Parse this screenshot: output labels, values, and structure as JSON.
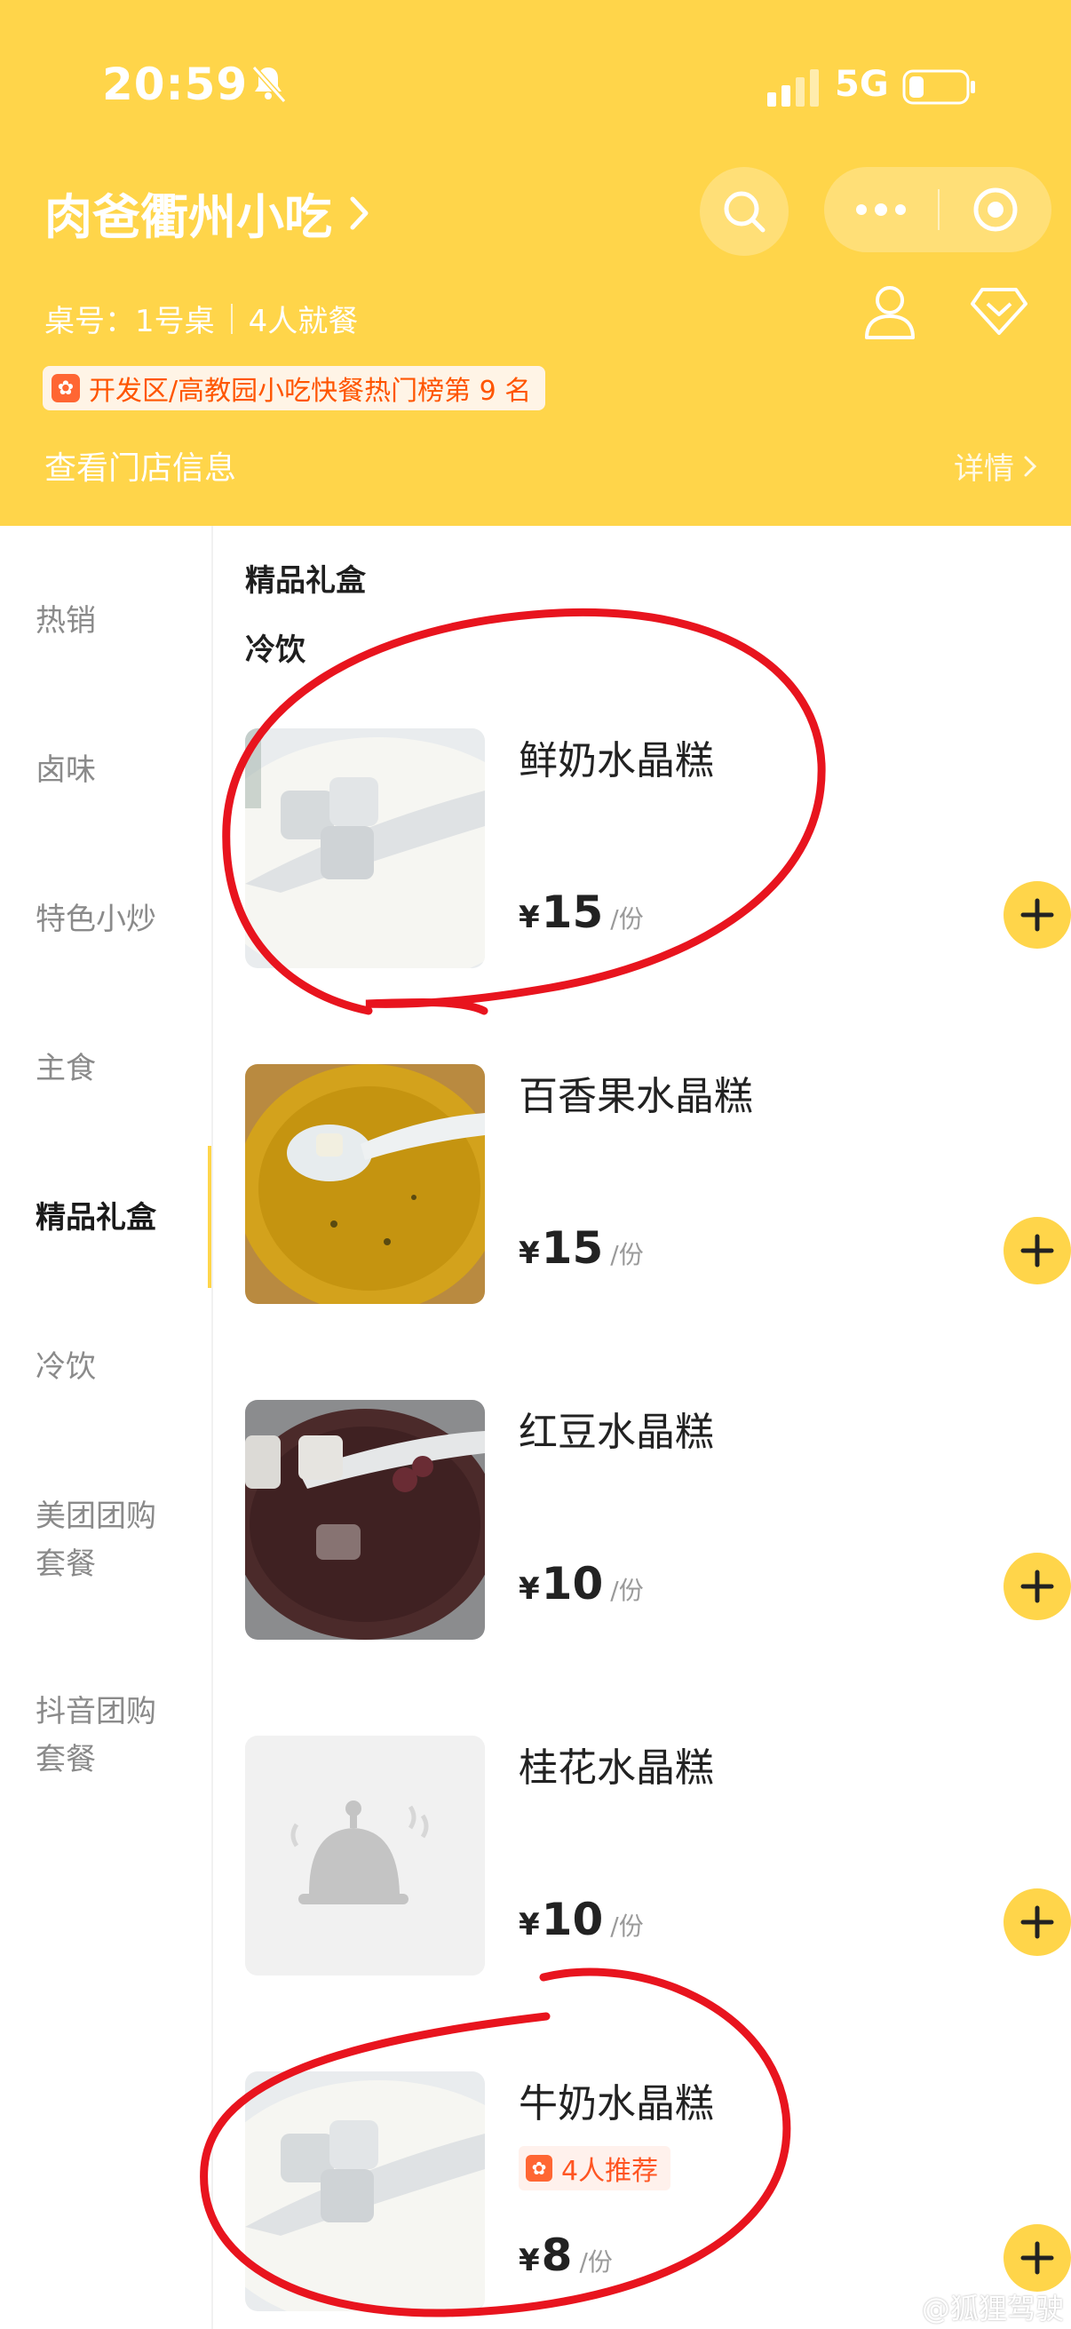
{
  "status_bar": {
    "time": "20:59",
    "network": "5G"
  },
  "header": {
    "shop_title": "肉爸衢州小吃",
    "table_label": "桌号：1号桌",
    "diners_label": "4人就餐",
    "rank_badge_text": "开发区/高教园小吃快餐热门榜第 9 名",
    "shop_info_link": "查看门店信息",
    "detail_link": "详情"
  },
  "sidebar": {
    "items": [
      {
        "label": "热销",
        "active": false
      },
      {
        "label": "卤味",
        "active": false
      },
      {
        "label": "特色小炒",
        "active": false
      },
      {
        "label": "主食",
        "active": false
      },
      {
        "label": "精品礼盒",
        "active": true
      },
      {
        "label": "冷饮",
        "active": false
      },
      {
        "label": "美团团购\n套餐",
        "active": false
      },
      {
        "label": "抖音团购\n套餐",
        "active": false
      }
    ]
  },
  "content": {
    "section_headers": [
      "精品礼盒",
      "冷饮"
    ],
    "dishes": [
      {
        "name": "鲜奶水晶糕",
        "currency": "¥",
        "price": "15",
        "unit": "/份",
        "image": "milk-jelly-photo",
        "recommend": ""
      },
      {
        "name": "百香果水晶糕",
        "currency": "¥",
        "price": "15",
        "unit": "/份",
        "image": "passionfruit-jelly-photo",
        "recommend": ""
      },
      {
        "name": "红豆水晶糕",
        "currency": "¥",
        "price": "10",
        "unit": "/份",
        "image": "redbean-jelly-photo",
        "recommend": ""
      },
      {
        "name": "桂花水晶糕",
        "currency": "¥",
        "price": "10",
        "unit": "/份",
        "image": "placeholder-dish-icon",
        "recommend": ""
      },
      {
        "name": "牛奶水晶糕",
        "currency": "¥",
        "price": "8",
        "unit": "/份",
        "image": "milk-jelly-photo",
        "recommend": "4人推荐"
      }
    ]
  },
  "watermark": "@狐狸驾驶",
  "colors": {
    "brand_yellow": "#FFD54A",
    "dianping_orange": "#FF6633",
    "annotation_red": "#E8141E"
  }
}
